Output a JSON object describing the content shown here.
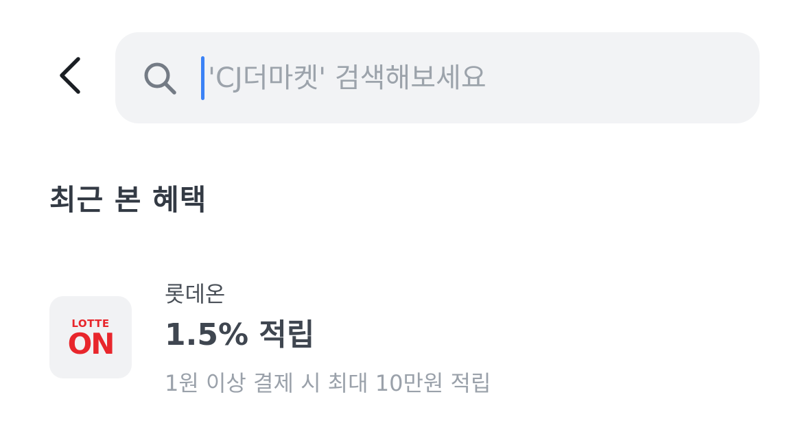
{
  "search": {
    "placeholder": "'CJ더마켓' 검색해보세요"
  },
  "recent": {
    "section_title": "최근 본 혜택",
    "items": [
      {
        "merchant": "롯데온",
        "logo_top": "LOTTE",
        "logo_bottom": "ON",
        "headline": "1.5% 적립",
        "description": "1원 이상 결제 시 최대 10만원 적립"
      }
    ]
  },
  "colors": {
    "search_background": "#f2f3f5",
    "caret": "#3b82f6",
    "logo_red": "#e8262c"
  },
  "icons": {
    "back": "chevron-left-icon",
    "search": "search-icon"
  }
}
